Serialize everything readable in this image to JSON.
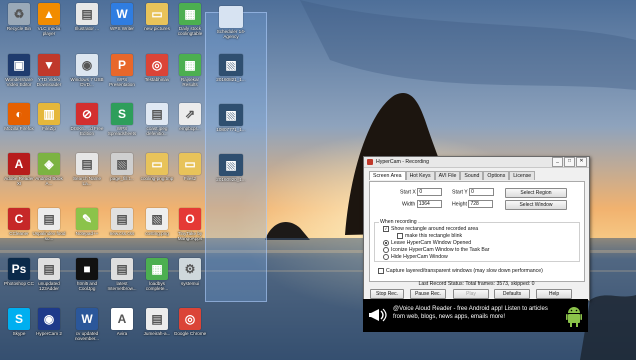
{
  "desktop": {
    "icons": [
      {
        "label": "Recycle Bin",
        "icon": "recycle-bin-icon",
        "color": "#9aa9b8",
        "glyph": "♻"
      },
      {
        "label": "VLC media player",
        "icon": "vlc-icon",
        "color": "#f28c00",
        "glyph": "▲"
      },
      {
        "label": "Illustrator ...",
        "icon": "document-icon",
        "color": "#e8e8e8",
        "glyph": "▤"
      },
      {
        "label": "WPS Writer",
        "icon": "wps-writer-icon",
        "color": "#2f7de1",
        "glyph": "W"
      },
      {
        "label": "new pictures",
        "icon": "folder-icon",
        "color": "#e8c35a",
        "glyph": "▭"
      },
      {
        "label": "Daily stock coolingtable",
        "icon": "spreadsheet-icon",
        "color": "#4caf50",
        "glyph": "▦"
      },
      {
        "label": "Wondershare Video Editor",
        "icon": "video-editor-icon",
        "color": "#1f3b6e",
        "glyph": "▣"
      },
      {
        "label": "YTD Video Downloader",
        "icon": "ytd-icon",
        "color": "#c0392b",
        "glyph": "▼"
      },
      {
        "label": "Windows 7 USB DVD...",
        "icon": "usb-dvd-tool-icon",
        "color": "#dde6f0",
        "glyph": "◉"
      },
      {
        "label": "WPS Presentation",
        "icon": "wps-presentation-icon",
        "color": "#e8672a",
        "glyph": "P"
      },
      {
        "label": "Testabhinav",
        "icon": "chrome-icon",
        "color": "#db4437",
        "glyph": "◎"
      },
      {
        "label": "Rajsekar Results",
        "icon": "spreadsheet-icon",
        "color": "#4caf50",
        "glyph": "▦"
      },
      {
        "label": "Mozilla Firefox",
        "icon": "firefox-icon",
        "color": "#e66000",
        "glyph": "◐"
      },
      {
        "label": "FileZip",
        "icon": "archive-icon",
        "color": "#e5b73b",
        "glyph": "▥"
      },
      {
        "label": "DISK6.....d Free Edition",
        "icon": "blocked-icon",
        "color": "#d32f2f",
        "glyph": "⊘"
      },
      {
        "label": "WPS Spreadsheets",
        "icon": "wps-spreadsheets-icon",
        "color": "#2e9e5b",
        "glyph": "S"
      },
      {
        "label": "coast.jpeg defenitio...",
        "icon": "document-icon",
        "color": "#dfe8f3",
        "glyph": "▤"
      },
      {
        "label": "empbcpr...",
        "icon": "shortcut-icon",
        "color": "#ececec",
        "glyph": "⇗"
      },
      {
        "label": "Adobe Reader XI",
        "icon": "pdf-reader-icon",
        "color": "#b71c1c",
        "glyph": "A"
      },
      {
        "label": "Android Book A...",
        "icon": "android-book-icon",
        "color": "#7cb342",
        "glyph": "◈"
      },
      {
        "label": "Search Name La...",
        "icon": "document-icon",
        "color": "#e6e6e6",
        "glyph": "▤"
      },
      {
        "label": "page_fill.t...",
        "icon": "image-file-icon",
        "color": "#cfcfcf",
        "glyph": "▧"
      },
      {
        "label": "cooling-png.tmp",
        "icon": "folder-icon",
        "color": "#e8c35a",
        "glyph": "▭"
      },
      {
        "label": "Files2",
        "icon": "folder-icon",
        "color": "#e8c35a",
        "glyph": "▭"
      },
      {
        "label": "CCleaner",
        "icon": "ccleaner-icon",
        "color": "#c62828",
        "glyph": "C"
      },
      {
        "label": "Uspalindex food so...",
        "icon": "document-icon",
        "color": "#ececec",
        "glyph": "▤"
      },
      {
        "label": "Notepad++",
        "icon": "notepad-icon",
        "color": "#8bc34a",
        "glyph": "✎"
      },
      {
        "label": "new.css.css",
        "icon": "css-file-icon",
        "color": "#e0e0e0",
        "glyph": "▤"
      },
      {
        "label": "costing.png",
        "icon": "image-file-icon",
        "color": "#eeeeee",
        "glyph": "▧"
      },
      {
        "label": "TinyTake by MangoApps",
        "icon": "tinytake-icon",
        "color": "#e53935",
        "glyph": "O"
      },
      {
        "label": "Photoshop CC",
        "icon": "photoshop-icon",
        "color": "#0b2a4a",
        "glyph": "Ps"
      },
      {
        "label": "unupdated 123Adder",
        "icon": "document-icon",
        "color": "#e0e0e0",
        "glyph": "▤"
      },
      {
        "label": "html5 and CoolJpg",
        "icon": "black-app-icon",
        "color": "#111111",
        "glyph": "■"
      },
      {
        "label": "latest Internetbrow...",
        "icon": "document-icon",
        "color": "#dedede",
        "glyph": "▤"
      },
      {
        "label": "loadbys complete...",
        "icon": "spreadsheet-icon",
        "color": "#4caf50",
        "glyph": "▦"
      },
      {
        "label": "systemui",
        "icon": "gear-app-icon",
        "color": "#cfd8dc",
        "glyph": "⚙"
      },
      {
        "label": "Skype",
        "icon": "skype-icon",
        "color": "#00aff0",
        "glyph": "S"
      },
      {
        "label": "HyperCam 2",
        "icon": "hypercam-icon",
        "color": "#1e3a8a",
        "glyph": "◉"
      },
      {
        "label": "cv updated november...",
        "icon": "word-doc-icon",
        "color": "#2b579a",
        "glyph": "W"
      },
      {
        "label": "Avira",
        "icon": "avira-icon",
        "color": "#ffffff",
        "glyph": "A"
      },
      {
        "label": "Jumeirah-a...",
        "icon": "document-icon",
        "color": "#ececec",
        "glyph": "▤"
      },
      {
        "label": "Google Chrome",
        "icon": "chrome-icon",
        "color": "#db4437",
        "glyph": "◎"
      }
    ],
    "selected_icons": [
      {
        "label": "Scheduler 14-Agency",
        "icon": "window-icon"
      },
      {
        "label": "20160821_1...",
        "icon": "image-file-icon"
      },
      {
        "label": "10807771_1...",
        "icon": "image-file-icon"
      },
      {
        "label": "20160920_1...",
        "icon": "image-file-icon"
      }
    ]
  },
  "hypercam": {
    "title": "HyperCam - Recording",
    "window_buttons": [
      "_",
      "□",
      "✕"
    ],
    "tabs": [
      "Screen Area",
      "Hot Keys",
      "AVI File",
      "Sound",
      "Options",
      "License"
    ],
    "active_tab": "Screen Area",
    "fields": {
      "start_x_label": "Start X",
      "start_x": "0",
      "start_y_label": "Start Y",
      "start_y": "0",
      "width_label": "Width",
      "width": "1364",
      "height_label": "Height",
      "height": "728"
    },
    "select_region": "Select Region",
    "select_window": "Select Window",
    "group_title": "When recording",
    "options": [
      {
        "label": "Show rectangle around recorded area",
        "type": "checkbox",
        "checked": true
      },
      {
        "label": "make this rectangle blink",
        "type": "checkbox",
        "checked": false
      },
      {
        "label": "Leave HyperCam Window Opened",
        "type": "radio",
        "checked": true
      },
      {
        "label": "Iconize HyperCam Window to the Task Bar",
        "type": "radio",
        "checked": false
      },
      {
        "label": "Hide HyperCam Window",
        "type": "radio",
        "checked": false
      }
    ],
    "capture_layered": "Capture layered/transparent windows (may slow down performance)",
    "status": "Last Record Status: Total frames: 3573, skipped: 0",
    "buttons": [
      "Stop Rec.",
      "Pause Rec.",
      "Play",
      "Defaults",
      "Help"
    ]
  },
  "ad": {
    "text": "@Voice Aloud Reader - free Android app! Listen to articles from web, blogs, news apps, emails more!",
    "icon_left": "megaphone-icon",
    "icon_right": "android-icon"
  },
  "colors": {
    "sky_top": "#5b7fa8",
    "sky_mid": "#e9a366",
    "sea": "#4a6b8a"
  }
}
